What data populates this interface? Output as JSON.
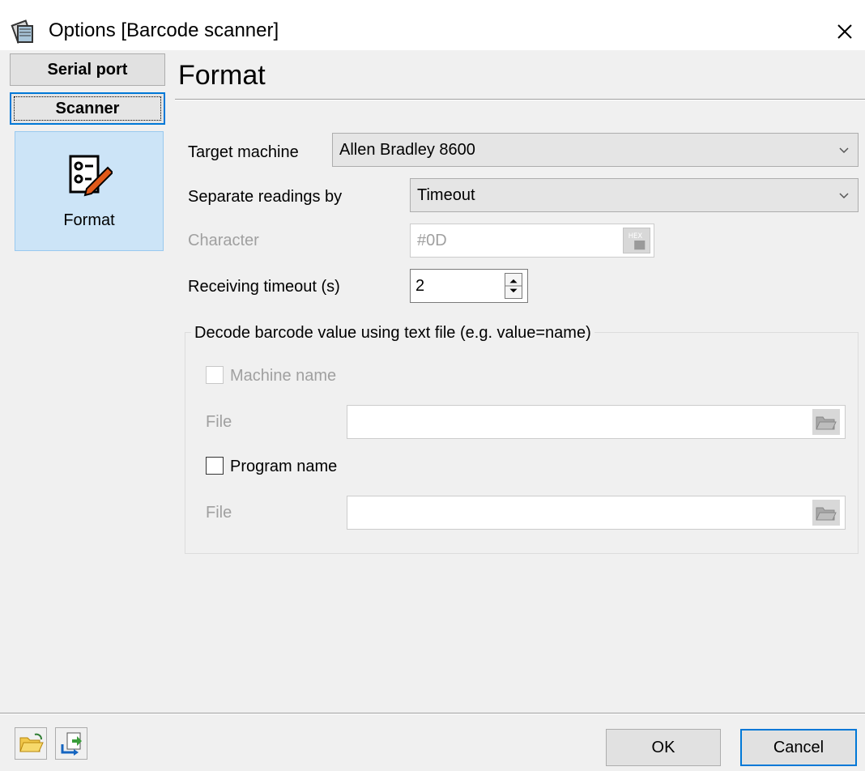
{
  "window": {
    "title": "Options [Barcode scanner]"
  },
  "sidebar": {
    "categories": [
      {
        "label": "Serial port"
      },
      {
        "label": "Scanner"
      }
    ],
    "pages": [
      {
        "label": "Format"
      }
    ]
  },
  "header": {
    "title": "Format"
  },
  "form": {
    "target_machine": {
      "label": "Target machine",
      "value": "Allen Bradley 8600"
    },
    "separate_by": {
      "label": "Separate readings by",
      "value": "Timeout"
    },
    "character": {
      "label": "Character",
      "value": "#0D"
    },
    "timeout": {
      "label": "Receiving timeout (s)",
      "value": "2"
    },
    "decode_group": {
      "label": "Decode barcode value using text file (e.g. value=name)",
      "machine_name": {
        "label": "Machine name",
        "checked": false
      },
      "machine_file": {
        "label": "File",
        "value": ""
      },
      "program_name": {
        "label": "Program name",
        "checked": false
      },
      "program_file": {
        "label": "File",
        "value": ""
      }
    }
  },
  "buttons": {
    "ok": "OK",
    "cancel": "Cancel"
  },
  "icons": {
    "title": "scanner-book-icon",
    "format": "checklist-pencil-icon",
    "hex": "hex-icon",
    "browse": "folder-browse-icon",
    "open": "open-folder-icon",
    "import": "import-icon"
  },
  "colors": {
    "accent": "#0078d7",
    "selected": "#cce4f7",
    "dialog": "#f0f0f0"
  }
}
